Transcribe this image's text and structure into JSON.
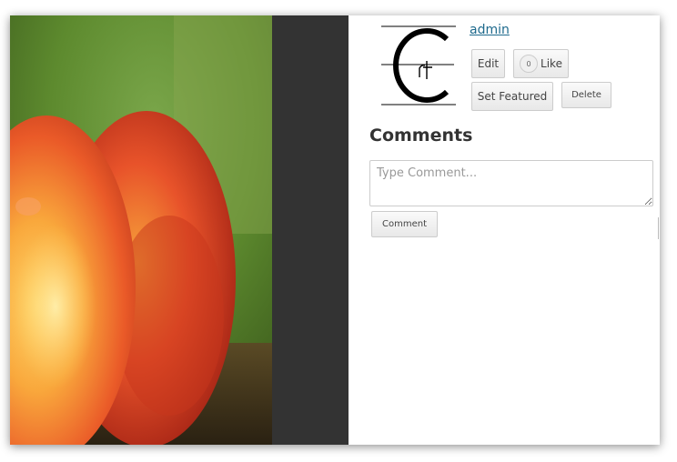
{
  "profile": {
    "username": "admin",
    "avatar_icon": "crt-logo-icon"
  },
  "actions": {
    "edit_label": "Edit",
    "like_count": "0",
    "like_label": "Like",
    "set_featured_label": "Set Featured",
    "delete_label": "Delete"
  },
  "comments": {
    "title": "Comments",
    "placeholder": "Type Comment...",
    "submit_label": "Comment"
  },
  "colors": {
    "link": "#1e6a8d",
    "dark_strip": "#333333"
  }
}
